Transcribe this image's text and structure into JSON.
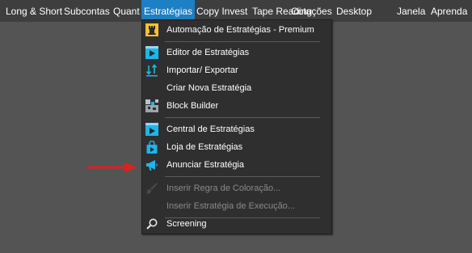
{
  "menubar": {
    "items": [
      {
        "label": "Long & Short"
      },
      {
        "label": "Subcontas"
      },
      {
        "label": "Quant"
      },
      {
        "label": "Estratégias"
      },
      {
        "label": "Copy Invest"
      },
      {
        "label": "Tape Reading"
      },
      {
        "label": "Cotações"
      },
      {
        "label": "Desktop"
      },
      {
        "label": "Janela"
      },
      {
        "label": "Aprenda"
      }
    ],
    "active": "Estratégias"
  },
  "dropdown": {
    "items": [
      {
        "label": "Automação de Estratégias - Premium",
        "icon": "chess-rook-icon",
        "enabled": true
      },
      {
        "label": "Editor de Estratégias",
        "icon": "editor-icon",
        "enabled": true
      },
      {
        "label": "Importar/ Exportar",
        "icon": "import-export-icon",
        "enabled": true
      },
      {
        "label": "Criar Nova Estratégia",
        "icon": "",
        "enabled": true
      },
      {
        "label": "Block Builder",
        "icon": "blocks-icon",
        "enabled": true
      },
      {
        "label": "Central de Estratégias",
        "icon": "central-icon",
        "enabled": true
      },
      {
        "label": "Loja de Estratégias",
        "icon": "shopping-bag-icon",
        "enabled": true
      },
      {
        "label": "Anunciar Estratégia",
        "icon": "megaphone-icon",
        "enabled": true
      },
      {
        "label": "Inserir Regra de Coloração...",
        "icon": "brush-icon",
        "enabled": false
      },
      {
        "label": "Inserir Estratégia de Execução...",
        "icon": "",
        "enabled": false
      },
      {
        "label": "Screening",
        "icon": "search-icon",
        "enabled": true
      }
    ]
  },
  "colors": {
    "menubar_bg": "#3e3e3e",
    "active_bg": "#1d7fc4",
    "dropdown_bg": "#2f2f2f",
    "accent_cyan": "#1fb5e8",
    "premium_gold": "#f2c230",
    "arrow_red": "#e0201b"
  }
}
